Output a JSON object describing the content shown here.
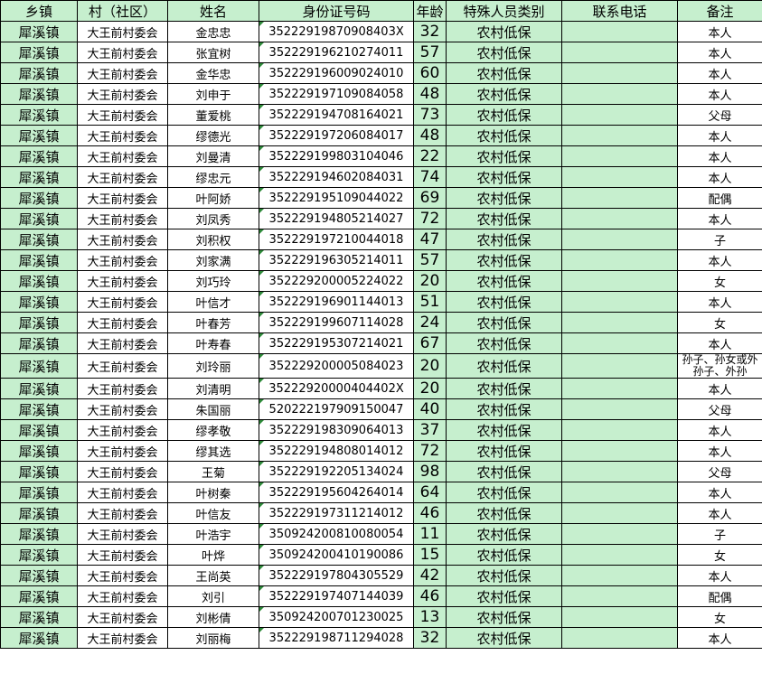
{
  "headers": [
    "乡镇",
    "村（社区）",
    "姓名",
    "身份证号码",
    "年龄",
    "特殊人员类别",
    "联系电话",
    "备注"
  ],
  "rows": [
    {
      "town": "犀溪镇",
      "village": "大王前村委会",
      "name": "金忠忠",
      "id": "35222919870908403X",
      "age": "32",
      "category": "农村低保",
      "phone": "",
      "note": "本人"
    },
    {
      "town": "犀溪镇",
      "village": "大王前村委会",
      "name": "张宜树",
      "id": "352229196210274011",
      "age": "57",
      "category": "农村低保",
      "phone": "",
      "note": "本人"
    },
    {
      "town": "犀溪镇",
      "village": "大王前村委会",
      "name": "金华忠",
      "id": "352229196009024010",
      "age": "60",
      "category": "农村低保",
      "phone": "",
      "note": "本人"
    },
    {
      "town": "犀溪镇",
      "village": "大王前村委会",
      "name": "刘申于",
      "id": "352229197109084058",
      "age": "48",
      "category": "农村低保",
      "phone": "",
      "note": "本人"
    },
    {
      "town": "犀溪镇",
      "village": "大王前村委会",
      "name": "董爱桃",
      "id": "352229194708164021",
      "age": "73",
      "category": "农村低保",
      "phone": "",
      "note": "父母"
    },
    {
      "town": "犀溪镇",
      "village": "大王前村委会",
      "name": "缪德光",
      "id": "352229197206084017",
      "age": "48",
      "category": "农村低保",
      "phone": "",
      "note": "本人"
    },
    {
      "town": "犀溪镇",
      "village": "大王前村委会",
      "name": "刘曼清",
      "id": "352229199803104046",
      "age": "22",
      "category": "农村低保",
      "phone": "",
      "note": "本人"
    },
    {
      "town": "犀溪镇",
      "village": "大王前村委会",
      "name": "缪忠元",
      "id": "352229194602084031",
      "age": "74",
      "category": "农村低保",
      "phone": "",
      "note": "本人"
    },
    {
      "town": "犀溪镇",
      "village": "大王前村委会",
      "name": "叶阿娇",
      "id": "352229195109044022",
      "age": "69",
      "category": "农村低保",
      "phone": "",
      "note": "配偶"
    },
    {
      "town": "犀溪镇",
      "village": "大王前村委会",
      "name": "刘凤秀",
      "id": "352229194805214027",
      "age": "72",
      "category": "农村低保",
      "phone": "",
      "note": "本人"
    },
    {
      "town": "犀溪镇",
      "village": "大王前村委会",
      "name": "刘积权",
      "id": "352229197210044018",
      "age": "47",
      "category": "农村低保",
      "phone": "",
      "note": "子"
    },
    {
      "town": "犀溪镇",
      "village": "大王前村委会",
      "name": "刘家满",
      "id": "352229196305214011",
      "age": "57",
      "category": "农村低保",
      "phone": "",
      "note": "本人"
    },
    {
      "town": "犀溪镇",
      "village": "大王前村委会",
      "name": "刘巧玲",
      "id": "352229200005224022",
      "age": "20",
      "category": "农村低保",
      "phone": "",
      "note": "女"
    },
    {
      "town": "犀溪镇",
      "village": "大王前村委会",
      "name": "叶信才",
      "id": "352229196901144013",
      "age": "51",
      "category": "农村低保",
      "phone": "",
      "note": "本人"
    },
    {
      "town": "犀溪镇",
      "village": "大王前村委会",
      "name": "叶春芳",
      "id": "352229199607114028",
      "age": "24",
      "category": "农村低保",
      "phone": "",
      "note": "女"
    },
    {
      "town": "犀溪镇",
      "village": "大王前村委会",
      "name": "叶寿春",
      "id": "352229195307214021",
      "age": "67",
      "category": "农村低保",
      "phone": "",
      "note": "本人"
    },
    {
      "town": "犀溪镇",
      "village": "大王前村委会",
      "name": "刘玲丽",
      "id": "352229200005084023",
      "age": "20",
      "category": "农村低保",
      "phone": "",
      "note": "孙子、孙女或外孙子、外孙"
    },
    {
      "town": "犀溪镇",
      "village": "大王前村委会",
      "name": "刘清明",
      "id": "35222920000404402X",
      "age": "20",
      "category": "农村低保",
      "phone": "",
      "note": "本人"
    },
    {
      "town": "犀溪镇",
      "village": "大王前村委会",
      "name": "朱国丽",
      "id": "520222197909150047",
      "age": "40",
      "category": "农村低保",
      "phone": "",
      "note": "父母"
    },
    {
      "town": "犀溪镇",
      "village": "大王前村委会",
      "name": "缪孝敬",
      "id": "352229198309064013",
      "age": "37",
      "category": "农村低保",
      "phone": "",
      "note": "本人"
    },
    {
      "town": "犀溪镇",
      "village": "大王前村委会",
      "name": "缪其选",
      "id": "352229194808014012",
      "age": "72",
      "category": "农村低保",
      "phone": "",
      "note": "本人"
    },
    {
      "town": "犀溪镇",
      "village": "大王前村委会",
      "name": "王菊",
      "id": "352229192205134024",
      "age": "98",
      "category": "农村低保",
      "phone": "",
      "note": "父母"
    },
    {
      "town": "犀溪镇",
      "village": "大王前村委会",
      "name": "叶树秦",
      "id": "352229195604264014",
      "age": "64",
      "category": "农村低保",
      "phone": "",
      "note": "本人"
    },
    {
      "town": "犀溪镇",
      "village": "大王前村委会",
      "name": "叶信友",
      "id": "352229197311214012",
      "age": "46",
      "category": "农村低保",
      "phone": "",
      "note": "本人"
    },
    {
      "town": "犀溪镇",
      "village": "大王前村委会",
      "name": "叶浩宇",
      "id": "350924200810080054",
      "age": "11",
      "category": "农村低保",
      "phone": "",
      "note": "子"
    },
    {
      "town": "犀溪镇",
      "village": "大王前村委会",
      "name": "叶烨",
      "id": "350924200410190086",
      "age": "15",
      "category": "农村低保",
      "phone": "",
      "note": "女"
    },
    {
      "town": "犀溪镇",
      "village": "大王前村委会",
      "name": "王尚英",
      "id": "352229197804305529",
      "age": "42",
      "category": "农村低保",
      "phone": "",
      "note": "本人"
    },
    {
      "town": "犀溪镇",
      "village": "大王前村委会",
      "name": "刘引",
      "id": "352229197407144039",
      "age": "46",
      "category": "农村低保",
      "phone": "",
      "note": "配偶"
    },
    {
      "town": "犀溪镇",
      "village": "大王前村委会",
      "name": "刘彬倩",
      "id": "350924200701230025",
      "age": "13",
      "category": "农村低保",
      "phone": "",
      "note": "女"
    },
    {
      "town": "犀溪镇",
      "village": "大王前村委会",
      "name": "刘丽梅",
      "id": "352229198711294028",
      "age": "32",
      "category": "农村低保",
      "phone": "",
      "note": "本人"
    }
  ]
}
